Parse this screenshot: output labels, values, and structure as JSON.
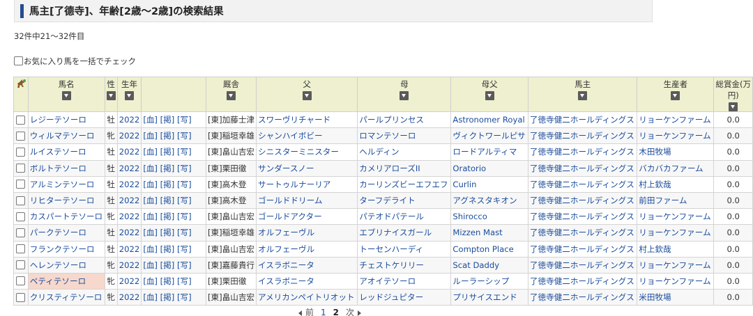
{
  "title": "馬主[了德寺]、年齢[2歳～2歳]の検索結果",
  "result_count": "32件中21～32件目",
  "check_all_label": "お気に入り馬を一括でチェック",
  "columns": {
    "name": "馬名",
    "sex": "性",
    "year": "生年",
    "stable": "厩舎",
    "sire": "父",
    "dam": "母",
    "damsire": "母父",
    "owner": "馬主",
    "breeder": "生産者",
    "prize": "総賞金(万円)"
  },
  "link_labels": {
    "blood": "[血]",
    "bbs": "[掲]",
    "photo": "[写]"
  },
  "rows": [
    {
      "name": "レジーテソーロ",
      "sex": "牡",
      "year": "2022",
      "stable": "[東]加藤士津",
      "sire": "スワーヴリチャード",
      "dam": "パールプリンセス",
      "damsire": "Astronomer Royal",
      "owner": "了徳寺健二ホールディングス",
      "breeder": "リョーケンファーム",
      "prize": "0.0"
    },
    {
      "name": "ウィルマテソーロ",
      "sex": "牝",
      "year": "2022",
      "stable": "[東]稲垣幸雄",
      "sire": "シャンハイボビー",
      "dam": "ロマンテソーロ",
      "damsire": "ヴィクトワールピサ",
      "owner": "了徳寺健二ホールディングス",
      "breeder": "リョーケンファーム",
      "prize": "0.0"
    },
    {
      "name": "ルイステソーロ",
      "sex": "牡",
      "year": "2022",
      "stable": "[東]畠山吉宏",
      "sire": "シニスターミニスター",
      "dam": "ヘルディン",
      "damsire": "ロードアルティマ",
      "owner": "了徳寺健二ホールディングス",
      "breeder": "木田牧場",
      "prize": "0.0"
    },
    {
      "name": "ボルトテソーロ",
      "sex": "牡",
      "year": "2022",
      "stable": "[東]栗田徹",
      "sire": "サンダースノー",
      "dam": "カメリアローズII",
      "damsire": "Oratorio",
      "owner": "了徳寺健二ホールディングス",
      "breeder": "バカバカファーム",
      "prize": "0.0"
    },
    {
      "name": "アルミンテソーロ",
      "sex": "牡",
      "year": "2022",
      "stable": "[東]高木登",
      "sire": "サートゥルナーリア",
      "dam": "カーリンズビーエフエフ",
      "damsire": "Curlin",
      "owner": "了徳寺健二ホールディングス",
      "breeder": "村上欽哉",
      "prize": "0.0"
    },
    {
      "name": "リヒターテソーロ",
      "sex": "牡",
      "year": "2022",
      "stable": "[東]高木登",
      "sire": "ゴールドドリーム",
      "dam": "ターフデライト",
      "damsire": "アグネスタキオン",
      "owner": "了徳寺健二ホールディングス",
      "breeder": "前田ファーム",
      "prize": "0.0"
    },
    {
      "name": "カスパートテソーロ",
      "sex": "牝",
      "year": "2022",
      "stable": "[東]畠山吉宏",
      "sire": "ゴールドアクター",
      "dam": "パテオドパテール",
      "damsire": "Shirocco",
      "owner": "了徳寺健二ホールディングス",
      "breeder": "リョーケンファーム",
      "prize": "0.0"
    },
    {
      "name": "パークテソーロ",
      "sex": "牡",
      "year": "2022",
      "stable": "[東]稲垣幸雄",
      "sire": "オルフェーヴル",
      "dam": "エブリナイスガール",
      "damsire": "Mizzen Mast",
      "owner": "了徳寺健二ホールディングス",
      "breeder": "リョーケンファーム",
      "prize": "0.0"
    },
    {
      "name": "フランクテソーロ",
      "sex": "牡",
      "year": "2022",
      "stable": "[東]畠山吉宏",
      "sire": "オルフェーヴル",
      "dam": "トーセンハーディ",
      "damsire": "Compton Place",
      "owner": "了徳寺健二ホールディングス",
      "breeder": "村上欽哉",
      "prize": "0.0"
    },
    {
      "name": "ヘレンテソーロ",
      "sex": "牝",
      "year": "2022",
      "stable": "[東]嘉藤貴行",
      "sire": "イスラボニータ",
      "dam": "チェストケリリー",
      "damsire": "Scat Daddy",
      "owner": "了徳寺健二ホールディングス",
      "breeder": "リョーケンファーム",
      "prize": "0.0"
    },
    {
      "name": "ベティテソーロ",
      "sex": "牝",
      "year": "2022",
      "stable": "[東]栗田徹",
      "sire": "イスラボニータ",
      "dam": "アオイテソーロ",
      "damsire": "ルーラーシップ",
      "owner": "了徳寺健二ホールディングス",
      "breeder": "リョーケンファーム",
      "prize": "0.0",
      "highlight": true
    },
    {
      "name": "クリスティテソーロ",
      "sex": "牝",
      "year": "2022",
      "stable": "[東]畠山吉宏",
      "sire": "アメリカンペイトリオット",
      "dam": "レッドジュピター",
      "damsire": "プリサイスエンド",
      "owner": "了徳寺健二ホールディングス",
      "breeder": "米田牧場",
      "prize": "0.0"
    }
  ],
  "pager": {
    "prev": "前",
    "next": "次",
    "pages": [
      "1",
      "2"
    ],
    "current": "2"
  },
  "colors": {
    "header_bg": "#eef0cf",
    "link": "#1a4c9c",
    "highlight": "#f6d8cc",
    "title_accent": "#234b8f"
  }
}
